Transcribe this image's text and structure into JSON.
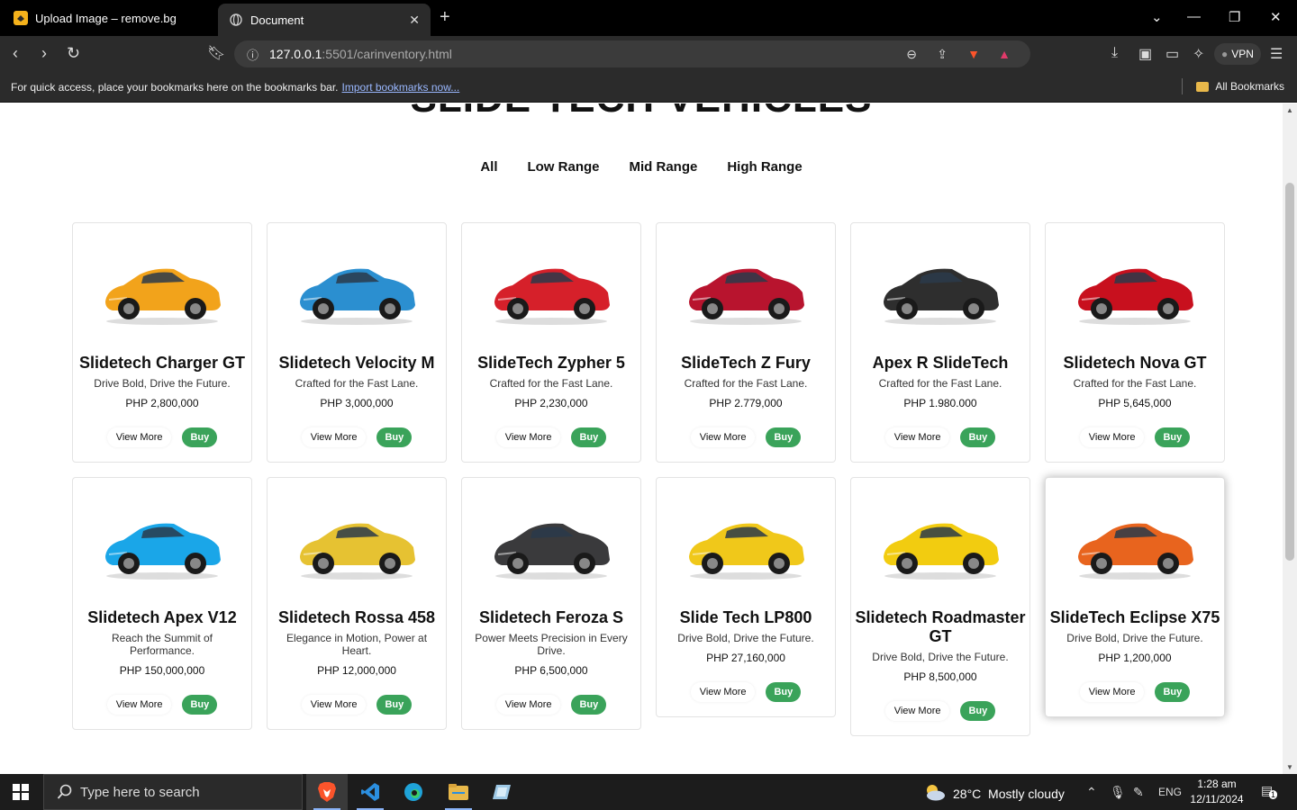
{
  "browser": {
    "tabs": [
      {
        "title": "Upload Image – remove.bg"
      },
      {
        "title": "Document"
      }
    ],
    "url_host": "127.0.0.1",
    "url_path": ":5501/carinventory.html",
    "vpn_label": "VPN",
    "bookmarks_bar": {
      "message": "For quick access, place your bookmarks here on the bookmarks bar.",
      "import_link": "Import bookmarks now...",
      "all_bookmarks": "All Bookmarks"
    }
  },
  "page": {
    "heading": "SLIDE TECH VEHICLES",
    "filters": [
      "All",
      "Low Range",
      "Mid Range",
      "High Range"
    ],
    "view_more_label": "View More",
    "buy_label": "Buy",
    "cars": [
      {
        "name": "Slidetech Charger GT",
        "tagline": "Drive Bold, Drive the Future.",
        "price": "PHP 2,800,000",
        "color": "#f2a31b"
      },
      {
        "name": "Slidetech Velocity M",
        "tagline": "Crafted for the Fast Lane.",
        "price": "PHP 3,000,000",
        "color": "#2b8fd0"
      },
      {
        "name": "SlideTech Zypher 5",
        "tagline": "Crafted for the Fast Lane.",
        "price": "PHP 2,230,000",
        "color": "#d6202a"
      },
      {
        "name": "SlideTech Z Fury",
        "tagline": "Crafted for the Fast Lane.",
        "price": "PHP 2.779,000",
        "color": "#b8142e"
      },
      {
        "name": "Apex R SlideTech",
        "tagline": "Crafted for the Fast Lane.",
        "price": "PHP 1.980.000",
        "color": "#2e2e2e"
      },
      {
        "name": "Slidetech Nova GT",
        "tagline": "Crafted for the Fast Lane.",
        "price": "PHP 5,645,000",
        "color": "#c8101e"
      },
      {
        "name": "Slidetech Apex V12",
        "tagline": "Reach the Summit of Performance.",
        "price": "PHP 150,000,000",
        "color": "#1aa6e8"
      },
      {
        "name": "Slidetech Rossa 458",
        "tagline": "Elegance in Motion, Power at Heart.",
        "price": "PHP 12,000,000",
        "color": "#e6c232"
      },
      {
        "name": "Slidetech Feroza S",
        "tagline": "Power Meets Precision in Every Drive.",
        "price": "PHP 6,500,000",
        "color": "#3a3a3c"
      },
      {
        "name": "Slide Tech LP800",
        "tagline": "Drive Bold, Drive the Future.",
        "price": "PHP 27,160,000",
        "color": "#f0c81a"
      },
      {
        "name": "Slidetech Roadmaster GT",
        "tagline": "Drive Bold, Drive the Future.",
        "price": "PHP 8,500,000",
        "color": "#f2cc10"
      },
      {
        "name": "SlideTech Eclipse X75",
        "tagline": "Drive Bold, Drive the Future.",
        "price": "PHP 1,200,000",
        "color": "#e8641e"
      }
    ]
  },
  "taskbar": {
    "search_placeholder": "Type here to search",
    "weather": "28°C  Mostly cloudy",
    "language": "ENG",
    "time": "1:28 am",
    "date": "12/11/2024",
    "notification_count": "1"
  }
}
